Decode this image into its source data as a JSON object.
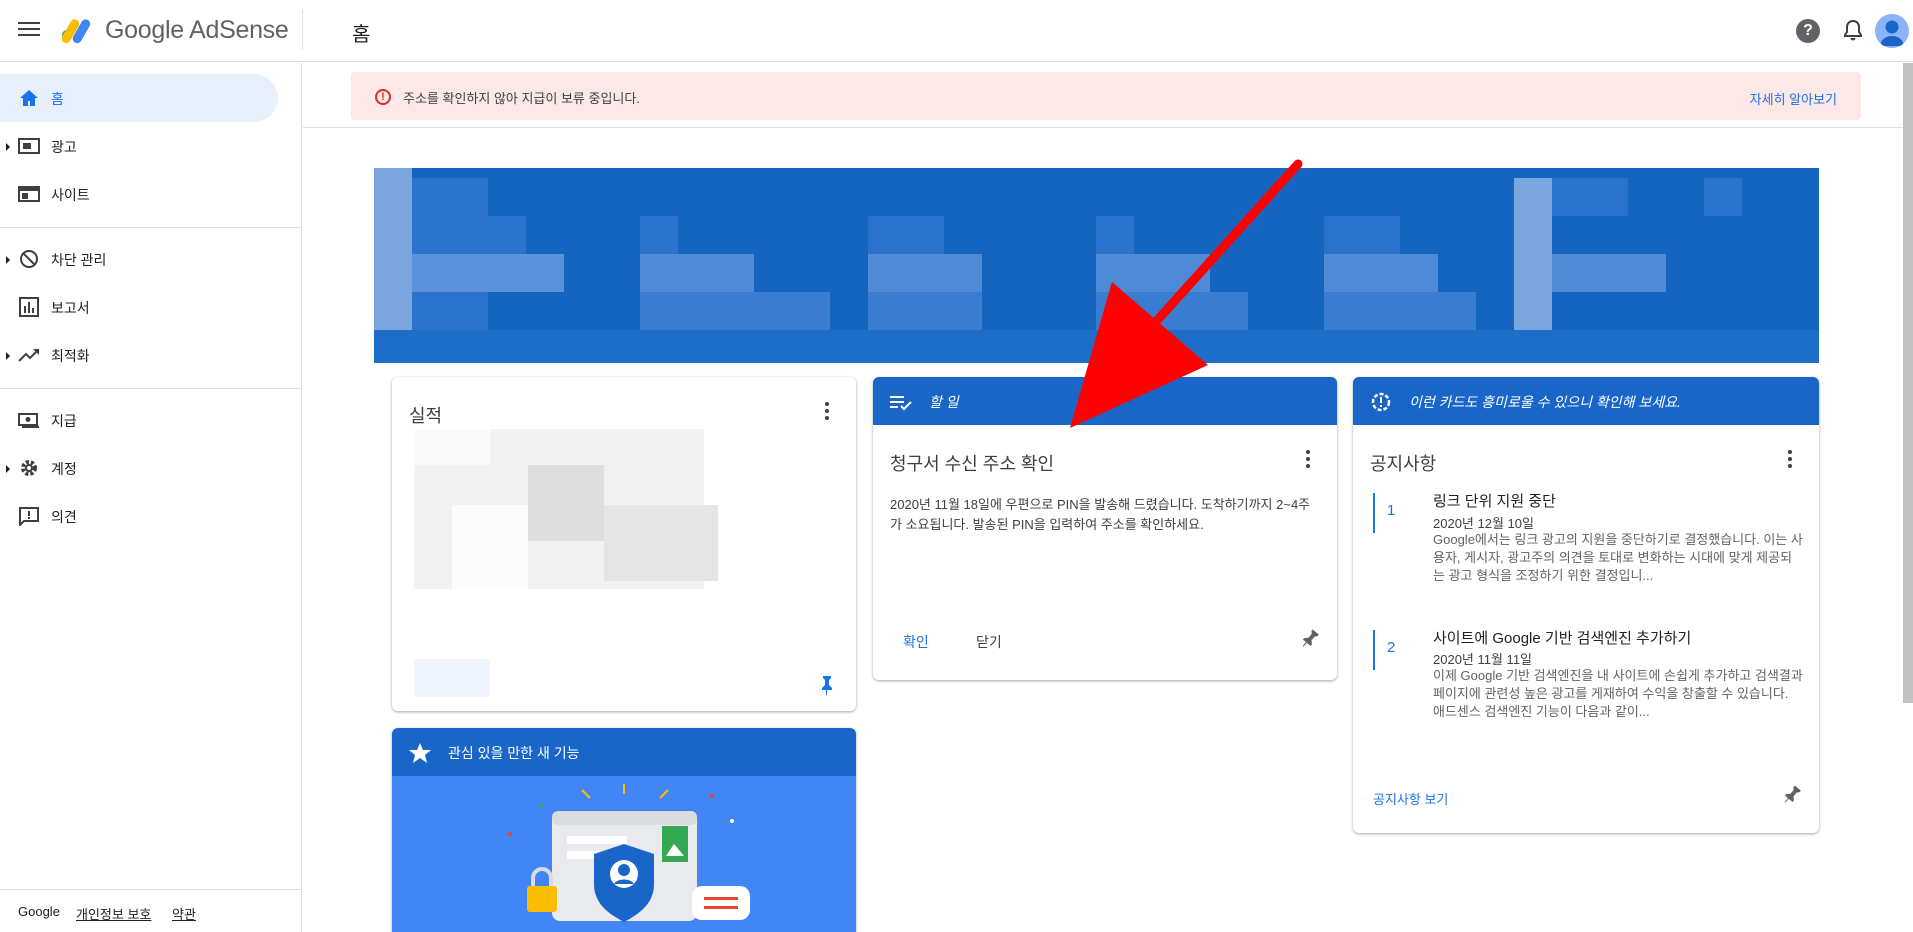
{
  "header": {
    "brand_google": "Google",
    "brand_product": "AdSense",
    "page_title": "홈"
  },
  "sidebar": {
    "items": [
      {
        "label": "홈",
        "icon": "home-icon"
      },
      {
        "label": "광고",
        "icon": "ads-icon"
      },
      {
        "label": "사이트",
        "icon": "sites-icon"
      },
      {
        "label": "차단 관리",
        "icon": "block-icon"
      },
      {
        "label": "보고서",
        "icon": "reports-icon"
      },
      {
        "label": "최적화",
        "icon": "trending-icon"
      },
      {
        "label": "지급",
        "icon": "payments-icon"
      },
      {
        "label": "계정",
        "icon": "settings-icon"
      },
      {
        "label": "의견",
        "icon": "feedback-icon"
      }
    ],
    "footer": {
      "google": "Google",
      "privacy": "개인정보 보호",
      "terms": "약관"
    }
  },
  "alert": {
    "text": "주소를 확인하지 않아 지급이 보류 중입니다.",
    "link": "자세히 알아보기",
    "color": "#fce8e6"
  },
  "cards": {
    "performance": {
      "title": "실적"
    },
    "new_features": {
      "header": "관심 있을 만한 새 기능"
    },
    "todo": {
      "header": "할 일",
      "title": "청구서 수신 주소 확인",
      "body": "2020년 11월 18일에 우편으로 PIN을 발송해 드렸습니다. 도착하기까지 2~4주가 소요됩니다. 발송된 PIN을 입력하여 주소를 확인하세요.",
      "confirm": "확인",
      "dismiss": "닫기"
    },
    "notices": {
      "header": "이런 카드도 흥미로울 수 있으니 확인해 보세요.",
      "title": "공지사항",
      "items": [
        {
          "num": "1",
          "title": "링크 단위 지원 중단",
          "date": "2020년 12월 10일",
          "body": "Google에서는 링크 광고의 지원을 중단하기로 결정했습니다. 이는 사용자, 게시자, 광고주의 의견을 토대로 변화하는 시대에 맞게 제공되는 광고 형식을 조정하기 위한 결정입니..."
        },
        {
          "num": "2",
          "title": "사이트에 Google 기반 검색엔진 추가하기",
          "date": "2020년 11월 11일",
          "body": "이제 Google 기반 검색엔진을 내 사이트에 손쉽게 추가하고 검색결과 페이지에 관련성 높은 광고를 게재하여 수익을 창출할 수 있습니다. 애드센스 검색엔진 기능이 다음과 같이..."
        }
      ],
      "view_all": "공지사항 보기"
    }
  },
  "colors": {
    "brand_blue": "#1a66c8",
    "link_blue": "#1a73e8",
    "annotation_arrow": "#ff0000"
  }
}
